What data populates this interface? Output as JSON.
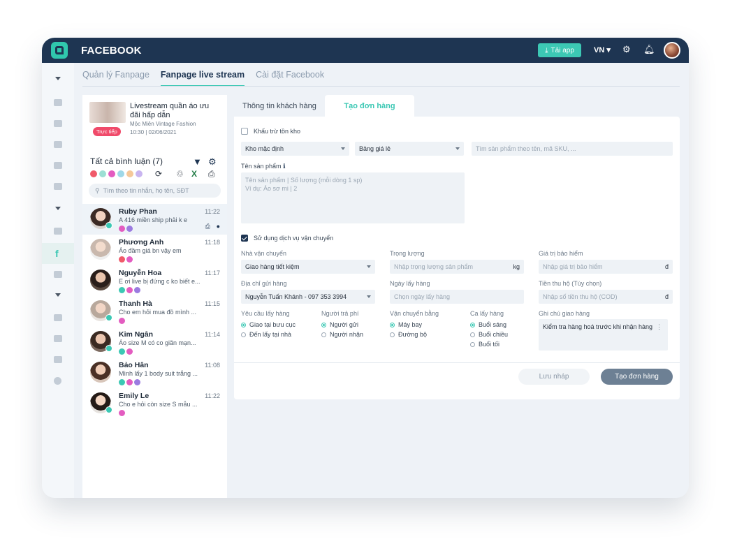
{
  "app": {
    "title": "FACEBOOK",
    "get_app_label": "Tải app",
    "lang": "VN",
    "colors": {
      "primary": "#1e3552",
      "accent": "#3cc8b4"
    }
  },
  "tabs": [
    {
      "label": "Quản lý Fanpage",
      "active": false
    },
    {
      "label": "Fanpage live stream",
      "active": true
    },
    {
      "label": "Cài đặt Facebook",
      "active": false
    }
  ],
  "live": {
    "title": "Livestream quần áo ưu đãi hấp dẫn",
    "shop": "Mộc Miên Vintage Fashion",
    "badge": "Trực tiếp",
    "time": "10:30 | 02/06/2021"
  },
  "comments": {
    "title": "Tất cả bình luận (7)",
    "search_placeholder": "Tìm theo tin nhắn, họ tên, SĐT",
    "items": [
      {
        "name": "Ruby Phan",
        "time": "11:22",
        "msg": "A 416 miền ship phải k e"
      },
      {
        "name": "Phương Anh",
        "time": "11:18",
        "msg": "Áo đầm giá bn vậy em"
      },
      {
        "name": "Nguyễn Hoa",
        "time": "11:17",
        "msg": "E ơi live bị đứng c ko biết e..."
      },
      {
        "name": "Thanh Hà",
        "time": "11:15",
        "msg": "Cho em hỏi mua đồ mình ..."
      },
      {
        "name": "Kim Ngân",
        "time": "11:14",
        "msg": "Áo size M có co giãn mạn..."
      },
      {
        "name": "Bảo Hân",
        "time": "11:08",
        "msg": "Mình lấy 1 body suit trắng ..."
      },
      {
        "name": "Emily Le",
        "time": "11:22",
        "msg": "Cho e hỏi còn size S mẫu ..."
      }
    ]
  },
  "order": {
    "tabs": [
      {
        "label": "Thông tin khách hàng"
      },
      {
        "label": "Tạo đơn hàng"
      }
    ],
    "deduct_label": "Khấu trừ tồn kho",
    "warehouse": "Kho mặc định",
    "price_list": "Bảng giá lẻ",
    "product_search_placeholder": "Tìm sản phẩm theo tên, mã SKU, ...",
    "product_label": "Tên sản phẩm",
    "product_placeholder_1": "Tên sản phẩm | Số lượng (mỗi dòng 1 sp)",
    "product_placeholder_2": "Ví dụ: Áo sơ mi | 2",
    "use_shipping_label": "Sử dụng dịch vụ vận chuyển",
    "carrier_label": "Nhà vận chuyển",
    "carrier_value": "Giao hàng tiết kiệm",
    "weight_label": "Trọng lượng",
    "weight_placeholder": "Nhập trọng lượng sản phẩm",
    "weight_unit": "kg",
    "insurance_label": "Giá trị bảo hiểm",
    "insurance_placeholder": "Nhập giá trị bảo hiểm",
    "currency": "đ",
    "sender_label": "Địa chỉ gửi hàng",
    "sender_value": "Nguyễn Tuấn Khánh - 097 353 3994",
    "pickup_date_label": "Ngày lấy hàng",
    "pickup_date_placeholder": "Chọn ngày lấy hàng",
    "cod_label": "Tiền thu hộ (Tùy chọn)",
    "cod_placeholder": "Nhập số tiền thu hộ (COD)",
    "pickup_req_label": "Yêu cầu lấy hàng",
    "pickup_req_options": [
      "Giao tại bưu cục",
      "Đến lấy tại nhà"
    ],
    "payer_label": "Người trả phí",
    "payer_options": [
      "Người gửi",
      "Người nhận"
    ],
    "transport_label": "Vận chuyển bằng",
    "transport_options": [
      "Máy bay",
      "Đường bộ"
    ],
    "shift_label": "Ca lấy hàng",
    "shift_options": [
      "Buổi sáng",
      "Buổi chiều",
      "Buổi tối"
    ],
    "note_label": "Ghi chú giao hàng",
    "note_value": "Kiểm tra hàng hoá trước khi nhận hàng",
    "draft_label": "Lưu nháp",
    "create_label": "Tạo đơn hàng"
  }
}
